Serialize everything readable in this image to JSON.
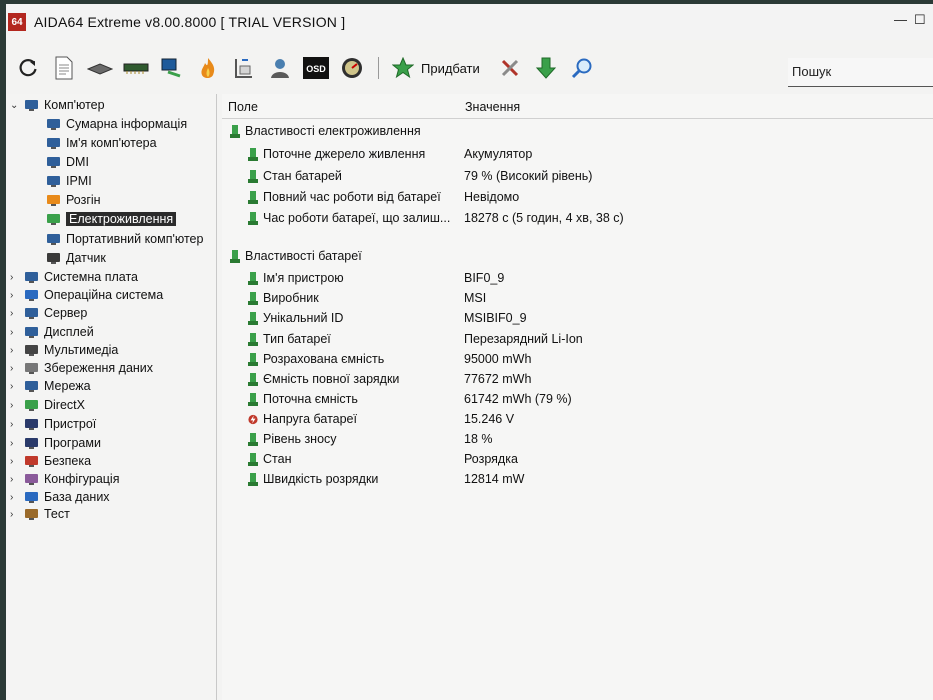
{
  "window": {
    "app_icon_text": "64",
    "title": "AIDA64 Extreme v8.00.8000  [ TRIAL VERSION ]",
    "minimize": "—",
    "maximize": "☐"
  },
  "toolbar": {
    "buttons": [
      "refresh-icon",
      "report-icon",
      "motherboard-icon",
      "memory-icon",
      "network-icon",
      "flame-icon",
      "stress-icon",
      "user-icon",
      "osd-icon",
      "gauge-icon"
    ],
    "add_label": "Придбати",
    "extra_buttons": [
      "tools-icon",
      "download-icon",
      "search-icon"
    ]
  },
  "search": {
    "placeholder": "Пошук"
  },
  "tree": {
    "items": [
      {
        "label": "Комп'ютер",
        "level": 0,
        "expanded": true,
        "icon": "computer-icon"
      },
      {
        "label": "Сумарна інформація",
        "level": 1,
        "icon": "summary-icon"
      },
      {
        "label": "Ім'я комп'ютера",
        "level": 1,
        "icon": "computer-name-icon"
      },
      {
        "label": "DMI",
        "level": 1,
        "icon": "dmi-icon"
      },
      {
        "label": "IPMI",
        "level": 1,
        "icon": "ipmi-icon"
      },
      {
        "label": "Розгін",
        "level": 1,
        "icon": "overclock-icon"
      },
      {
        "label": "Електроживлення",
        "level": 1,
        "icon": "power-icon",
        "selected": true
      },
      {
        "label": "Портативний комп'ютер",
        "level": 1,
        "icon": "portable-icon"
      },
      {
        "label": "Датчик",
        "level": 1,
        "icon": "sensor-icon"
      },
      {
        "label": "Системна плата",
        "level": 0,
        "icon": "motherboard-icon"
      },
      {
        "label": "Операційна система",
        "level": 0,
        "icon": "windows-icon"
      },
      {
        "label": "Сервер",
        "level": 0,
        "icon": "server-icon"
      },
      {
        "label": "Дисплей",
        "level": 0,
        "icon": "display-icon"
      },
      {
        "label": "Мультимедіа",
        "level": 0,
        "icon": "multimedia-icon"
      },
      {
        "label": "Збереження даних",
        "level": 0,
        "icon": "storage-icon"
      },
      {
        "label": "Мережа",
        "level": 0,
        "icon": "network-icon"
      },
      {
        "label": "DirectX",
        "level": 0,
        "icon": "directx-icon"
      },
      {
        "label": "Пристрої",
        "level": 0,
        "icon": "devices-icon"
      },
      {
        "label": "Програми",
        "level": 0,
        "icon": "programs-icon"
      },
      {
        "label": "Безпека",
        "level": 0,
        "icon": "security-icon"
      },
      {
        "label": "Конфігурація",
        "level": 0,
        "icon": "config-icon"
      },
      {
        "label": "База даних",
        "level": 0,
        "icon": "database-icon"
      },
      {
        "label": "Тест",
        "level": 0,
        "icon": "test-icon"
      }
    ]
  },
  "table": {
    "col_field": "Поле",
    "col_value": "Значення",
    "sections": [
      {
        "title": "Властивості електроживлення",
        "rows": [
          {
            "field": "Поточне джерело живлення",
            "value": "Акумулятор"
          },
          {
            "field": "Стан батарей",
            "value": "79 % (Високий рівень)"
          },
          {
            "field": "Повний час роботи від батареї",
            "value": "Невідомо"
          },
          {
            "field": "Час роботи батареї, що залиш...",
            "value": "18278 с (5 годин, 4 хв, 38 с)"
          }
        ]
      },
      {
        "title": "Властивості батареї",
        "rows": [
          {
            "field": "Ім'я пристрою",
            "value": "BIF0_9"
          },
          {
            "field": "Виробник",
            "value": "MSI"
          },
          {
            "field": "Унікальний ID",
            "value": "MSIBIF0_9"
          },
          {
            "field": "Тип батареї",
            "value": "Перезарядний Li-Ion"
          },
          {
            "field": "Розрахована ємність",
            "value": "95000 mWh"
          },
          {
            "field": "Ємність повної зарядки",
            "value": "77672 mWh"
          },
          {
            "field": "Поточна ємність",
            "value": "61742 mWh  (79 %)"
          },
          {
            "field": "Напруга батареї",
            "value": "15.246 V",
            "icon": "voltage-icon"
          },
          {
            "field": "Рівень зносу",
            "value": "18 %"
          },
          {
            "field": "Стан",
            "value": "Розрядка"
          },
          {
            "field": "Швидкість розрядки",
            "value": "12814 mW"
          }
        ]
      }
    ]
  }
}
